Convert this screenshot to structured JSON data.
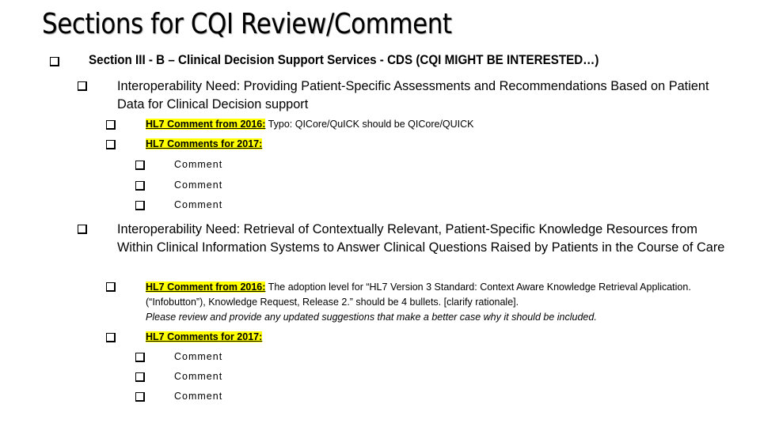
{
  "slide": {
    "title": "Sections for CQI Review/Comment",
    "highlight_color": "#ffff00",
    "section": {
      "label": "Section III - B – Clinical Decision Support Services - CDS  (CQI MIGHT BE INTERESTED…)",
      "needs": [
        {
          "label": "Interoperability Need: Providing Patient-Specific Assessments and Recommendations Based on Patient Data for Clinical Decision support",
          "comment_2016": {
            "heading": "HL7 Comment from 2016:",
            "text": " Typo: QICore/QuICK should be QICore/QUICK"
          },
          "comments_2017": {
            "heading": "HL7 Comments for 2017",
            "colon": ":",
            "items": [
              "Comment",
              "Comment",
              "Comment"
            ]
          }
        },
        {
          "label": "Interoperability Need: Retrieval of Contextually Relevant, Patient-Specific Knowledge Resources from Within Clinical Information Systems to Answer Clinical Questions Raised by Patients in the Course of Care",
          "comment_2016": {
            "heading": "HL7 Comment from 2016:",
            "text": " The adoption level for “HL7 Version 3 Standard: Context Aware Knowledge Retrieval Application. (“Infobutton”), Knowledge Request, Release 2.” should  be 4 bullets.  [clarify rationale].",
            "italic_text": "Please review and provide any updated suggestions that make a better case why it should be included."
          },
          "comments_2017": {
            "heading": "HL7 Comments for 2017",
            "colon": ":",
            "items": [
              "Comment",
              "Comment",
              "Comment"
            ]
          }
        }
      ]
    }
  }
}
